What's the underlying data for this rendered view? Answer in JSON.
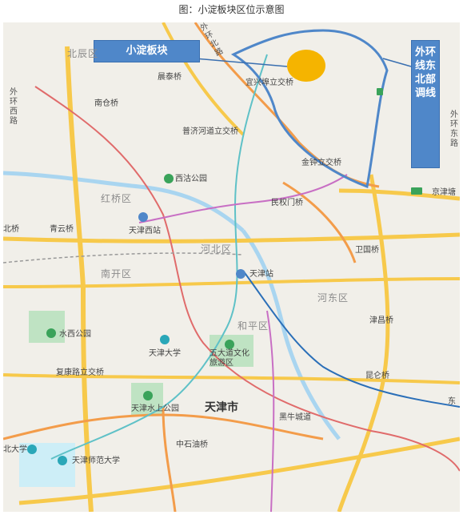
{
  "caption": "图：小淀板块区位示意图",
  "callouts": {
    "xiaodian": "小淀板块",
    "outer_ring": "外环线东北部调线"
  },
  "districts": {
    "beichen": "北辰区",
    "hongqiao": "红桥区",
    "hebei": "河北区",
    "nankai": "南开区",
    "hedong": "河东区",
    "heping": "和平区"
  },
  "city": "天津市",
  "places": {
    "jintai": "晨泰桥",
    "yixingbu": "宜兴埠立交桥",
    "nancang": "南仓桥",
    "puji": "普济河道立交桥",
    "xigu": "西沽公园",
    "jinzhong": "金钟立交桥",
    "minquan": "民权门桥",
    "qingyun": "青云桥",
    "tianjin_west": "天津西站",
    "weiguo": "卫国桥",
    "tianjin_station": "天津站",
    "shuixi": "水西公园",
    "tju": "天津大学",
    "wudadao": "五大道文化旅游区",
    "jinchang": "津昌桥",
    "fuxinglu": "复康路立交桥",
    "shuishang": "天津水上公园",
    "heiniu": "黑牛城道",
    "qiancang": "昆仑桥",
    "zhongshi": "中石油桥",
    "tnu": "天津师范大学",
    "jingjin": "京津塘",
    "dongli": "东",
    "left_edge": "北大学",
    "left_mid": "北桥"
  },
  "vertical_roads": {
    "left_outer": "外环西路",
    "right_outer": "外环东路",
    "top_road": "外环北路"
  },
  "colors": {
    "callout": "#4f87c9",
    "marker": "#f5b400",
    "park": "#8fd19e"
  }
}
